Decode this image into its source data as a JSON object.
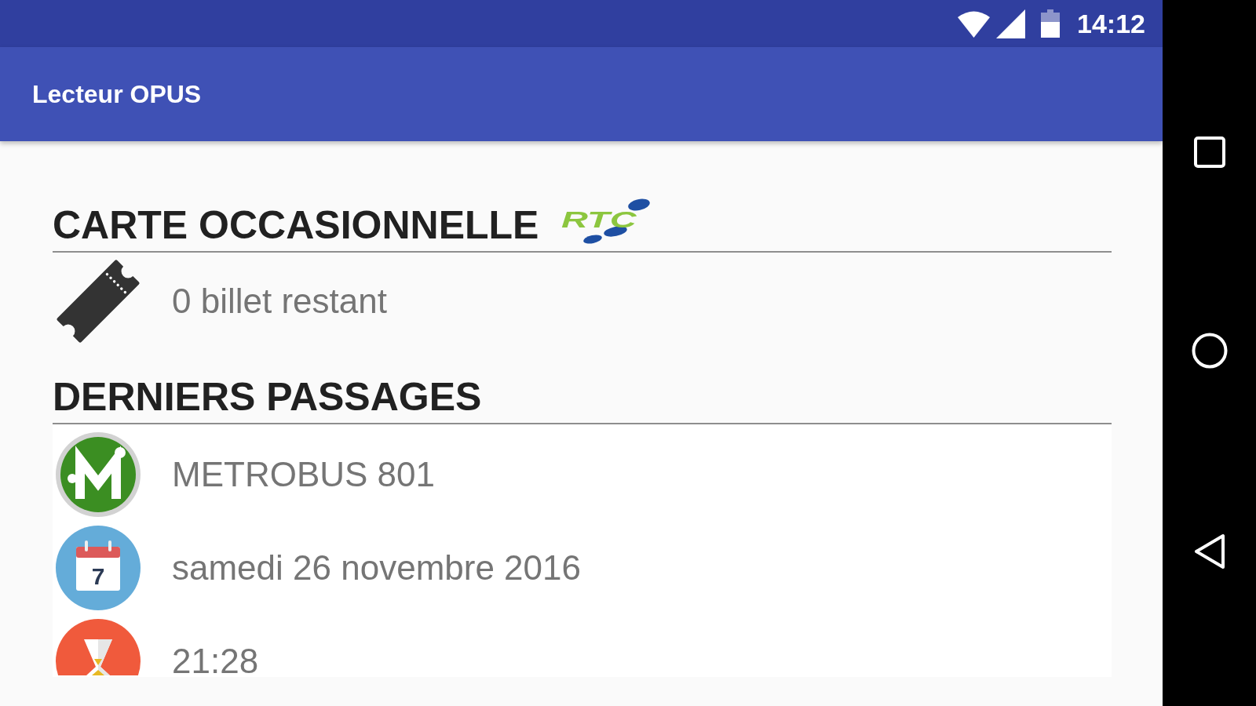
{
  "status_bar": {
    "time": "14:12"
  },
  "app_bar": {
    "title": "Lecteur OPUS"
  },
  "card_section": {
    "heading": "CARTE OCCASIONNELLE",
    "logo_text": "RTC",
    "tickets_remaining": "0 billet restant"
  },
  "last_passages": {
    "heading": "DERNIERS PASSAGES",
    "items": [
      {
        "kind": "route",
        "text": "METROBUS 801"
      },
      {
        "kind": "date",
        "text": "samedi 26 novembre 2016",
        "icon_text": "7"
      },
      {
        "kind": "time",
        "text": "21:28"
      }
    ]
  }
}
